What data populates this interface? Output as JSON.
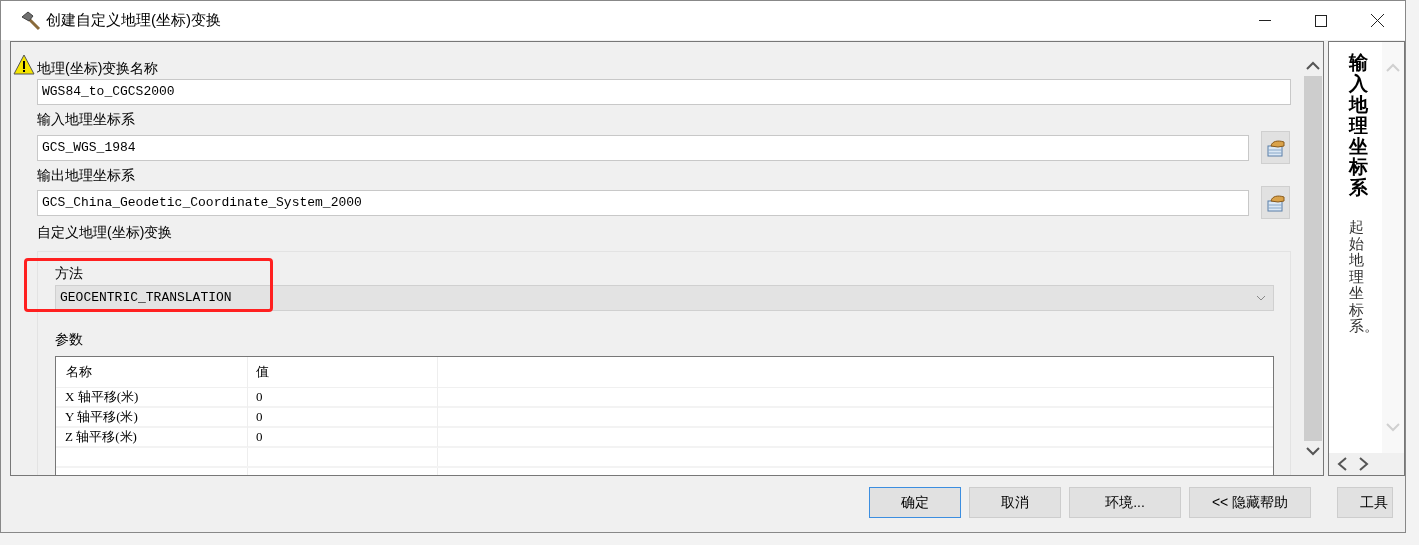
{
  "window": {
    "title": "创建自定义地理(坐标)变换"
  },
  "form": {
    "name_label": "地理(坐标)变换名称",
    "name_value": "WGS84_to_CGCS2000",
    "name_warning": true,
    "input_label": "输入地理坐标系",
    "input_value": "GCS_WGS_1984",
    "output_label": "输出地理坐标系",
    "output_value": "GCS_China_Geodetic_Coordinate_System_2000",
    "transform_label": "自定义地理(坐标)变换",
    "method_label": "方法",
    "method_value": "GEOCENTRIC_TRANSLATION",
    "method_highlighted": true,
    "params_label": "参数"
  },
  "table": {
    "columns": [
      "名称",
      "值"
    ],
    "rows": [
      {
        "name": "X 轴平移(米)",
        "value": "0"
      },
      {
        "name": "Y 轴平移(米)",
        "value": "0"
      },
      {
        "name": "Z 轴平移(米)",
        "value": "0"
      }
    ]
  },
  "help": {
    "title": "输入地理坐标系",
    "body": "起始地理坐标系。"
  },
  "buttons": [
    {
      "label": "确定",
      "selected": true
    },
    {
      "label": "取消",
      "selected": false
    },
    {
      "label": "环境...",
      "selected": false
    },
    {
      "label": "<< 隐藏帮助",
      "selected": false
    },
    {
      "label": "工具",
      "selected": false
    }
  ]
}
